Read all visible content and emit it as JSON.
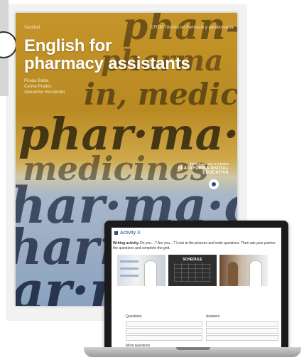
{
  "book": {
    "series": "Sanidad",
    "tagline": "CFGM Técnico en Farmacia y parafarmacia",
    "title_line1": "English for",
    "title_line2": "pharmacy assistants",
    "authors": [
      "Pirada Badia",
      "Carme Prades",
      "Alexandre Hernández"
    ],
    "background_words": [
      "phan-to",
      "pharma",
      "in, medic",
      "phar·ma·",
      "medicines",
      "har·ma·c",
      "harm",
      "ar·ma"
    ],
    "access_line": "Incluye acceso a nuestra",
    "access_brand": "PLATAFORMA DIGITAL EDUCATIVA",
    "platform_icon": "platform-logo-icon"
  },
  "laptop": {
    "activity_title": "Activity 3",
    "instructions_bold": "Writing activity.",
    "instructions_text": " Do you…? Are you…? Look at the pictures and write questions. Then ask your partner the questions and complete the grid.",
    "images": [
      "pharmacy-shelf-image",
      "schedule-board-image",
      "pharmacy-counter-image"
    ],
    "schedule_label": "SCHEDULE",
    "col_questions": "Questions",
    "col_answers": "Answers",
    "more_questions": "More questions"
  },
  "colors": {
    "accent_blue": "#2a4f84",
    "cover_gold": "#c5952a",
    "cover_blue": "#8aa2bf"
  }
}
